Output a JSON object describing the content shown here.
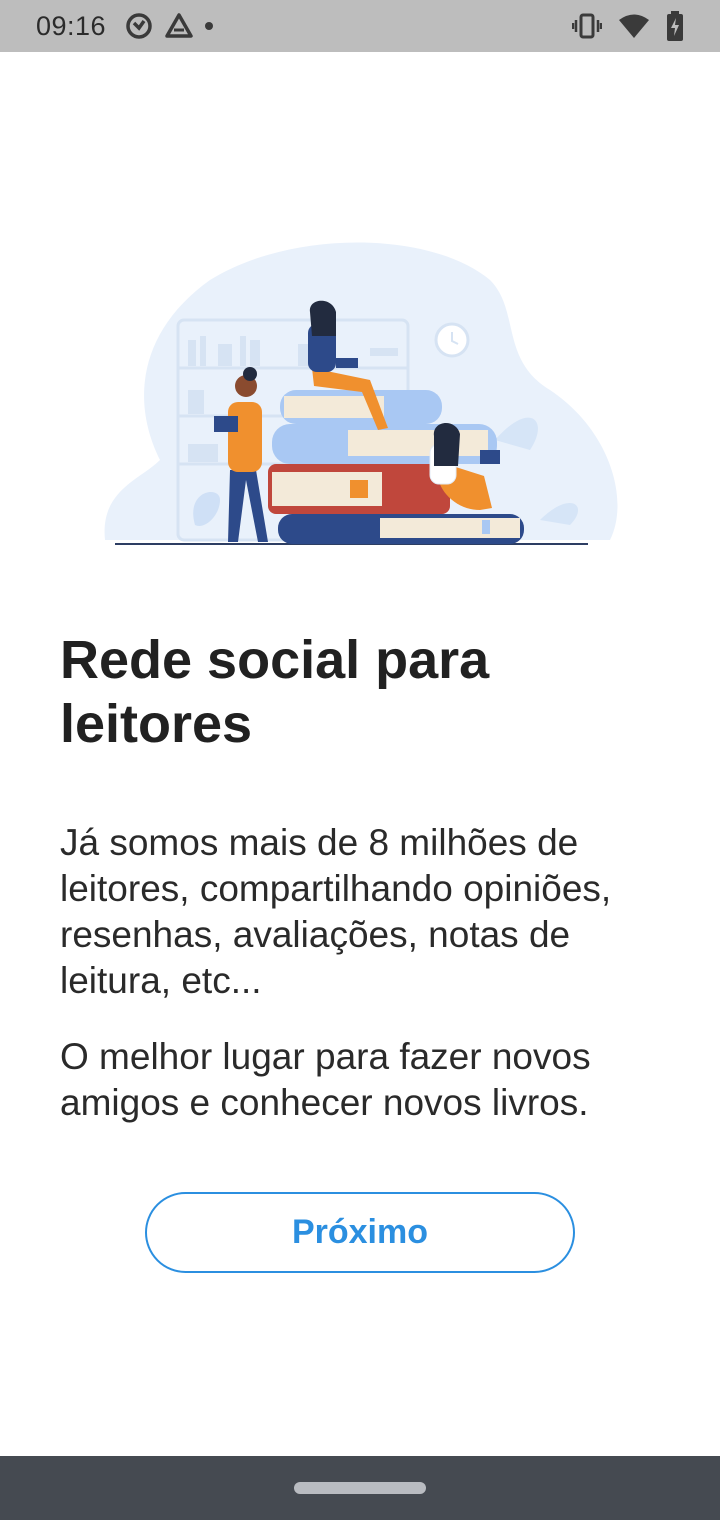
{
  "status_bar": {
    "time": "09:16",
    "left_icons": [
      "data-saver-icon",
      "drive-icon",
      "notification-dot-icon"
    ],
    "right_icons": [
      "vibrate-icon",
      "wifi-icon",
      "battery-charging-icon"
    ]
  },
  "illustration": {
    "name": "readers-on-books-illustration",
    "colors": {
      "blob": "#e9f1fb",
      "book_dark": "#2d4a8a",
      "book_red": "#c0473c",
      "book_light": "#a9c8f3",
      "pages": "#f3ead9",
      "orange": "#f0902e"
    }
  },
  "onboarding": {
    "title": "Rede social para leitores",
    "paragraph_1": "Já somos mais de 8 milhões de leitores, compartilhando opiniões, resenhas, avaliações, notas de leitura, etc...",
    "paragraph_2": "O melhor lugar para fazer novos amigos e conhecer novos livros.",
    "next_label": "Próximo"
  },
  "colors": {
    "accent": "#2b8fe0",
    "text": "#212121",
    "status_bar_bg": "#bdbdbd",
    "nav_bar_bg": "#454a51"
  }
}
